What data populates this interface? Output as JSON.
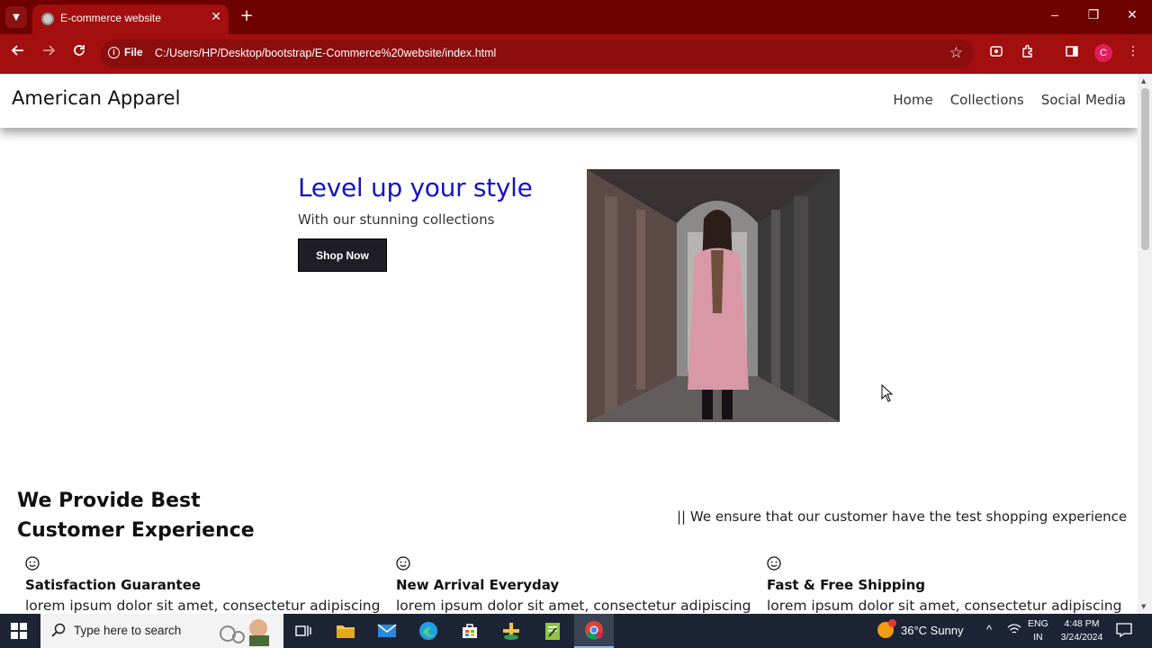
{
  "browser": {
    "tab_title": "E-commerce website",
    "tab_close": "✕",
    "new_tab": "+",
    "site_info_label": "File",
    "url": "C:/Users/HP/Desktop/bootstrap/E-Commerce%20website/index.html",
    "profile_initial": "C",
    "window": {
      "minimize": "–",
      "restore": "❐",
      "close": "✕"
    }
  },
  "site": {
    "brand": "American Apparel",
    "nav": [
      "Home",
      "Collections",
      "Social Media"
    ]
  },
  "hero": {
    "title": "Level up your style",
    "subtitle": "With our stunning collections",
    "button": "Shop Now",
    "image_icon": "woman-in-pink-coat-photo"
  },
  "experience": {
    "title": "We Provide Best Customer Experience",
    "tagline": "|| We ensure that our customer have the test shopping experience"
  },
  "features": [
    {
      "icon": "smiley-icon",
      "title": "Satisfaction Guarantee",
      "text": "lorem ipsum dolor sit amet, consectetur adipiscing"
    },
    {
      "icon": "smiley-icon",
      "title": "New Arrival Everyday",
      "text": "lorem ipsum dolor sit amet, consectetur adipiscing"
    },
    {
      "icon": "smiley-icon",
      "title": "Fast & Free Shipping",
      "text": "lorem ipsum dolor sit amet, consectetur adipiscing"
    }
  ],
  "taskbar": {
    "search_placeholder": "Type here to search",
    "weather": "36°C  Sunny",
    "lang_line1": "ENG",
    "lang_line2": "IN",
    "time": "4:48 PM",
    "date": "3/24/2024"
  },
  "colors": {
    "tabbar": "#6e0000",
    "toolbar": "#a30e0e",
    "hero_title": "#1414c8",
    "button_bg": "#1e1e24",
    "taskbar": "#1c2436"
  }
}
